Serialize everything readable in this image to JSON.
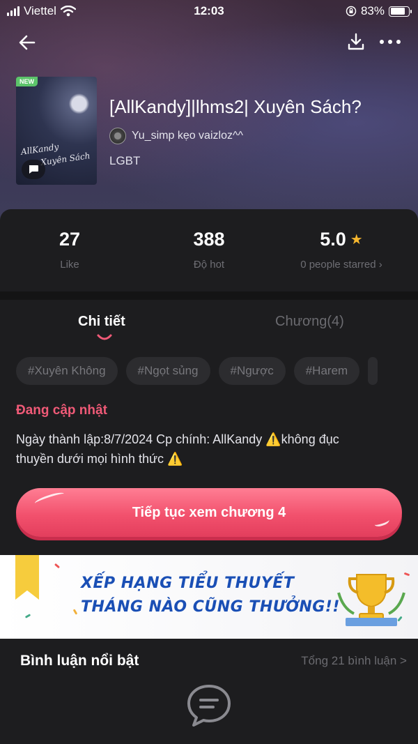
{
  "status_bar": {
    "carrier": "Viettel",
    "time": "12:03",
    "battery": "83%",
    "battery_level": 0.83
  },
  "nav": {
    "back_icon": "arrow-left-icon",
    "download_icon": "download-icon",
    "more_icon": "more-horizontal-icon"
  },
  "book": {
    "badge": "NEW",
    "cover_text_line1": "AllKandy",
    "cover_text_line2": "Xuyên Sách",
    "title": "[AllKandy]|lhms2| Xuyên Sách?",
    "author": "Yu_simp kẹo vaizloz^^",
    "genre": "LGBT"
  },
  "stats": {
    "likes_value": "27",
    "likes_label": "Like",
    "hot_value": "388",
    "hot_label": "Độ hot",
    "rating_value": "5.0",
    "rating_label": "0 people starred",
    "rating_chevron": "›"
  },
  "tabs": {
    "detail": "Chi tiết",
    "chapters": "Chương(4)"
  },
  "tags": [
    "#Xuyên Không",
    "#Ngọt sủng",
    "#Ngược",
    "#Harem"
  ],
  "detail": {
    "status": "Đang cập nhật",
    "description_line1": "Ngày thành lập:8/7/2024 Cp chính: AllKandy ⚠️không đục",
    "description_line2": "thuyền dưới mọi hình thức ⚠️"
  },
  "cta_label": "Tiếp tục xem chương 4",
  "banner": {
    "line1": "XẾP HẠNG TIỂU THUYẾT",
    "line2": "THÁNG NÀO CŨNG THƯỞNG!!"
  },
  "comments": {
    "title": "Bình luận nổi bật",
    "total": "Tổng 21 bình luận >"
  },
  "colors": {
    "accent": "#f05a77",
    "button": "#f2516d",
    "banner_text": "#1a4fb5",
    "star": "#f5b62e"
  }
}
